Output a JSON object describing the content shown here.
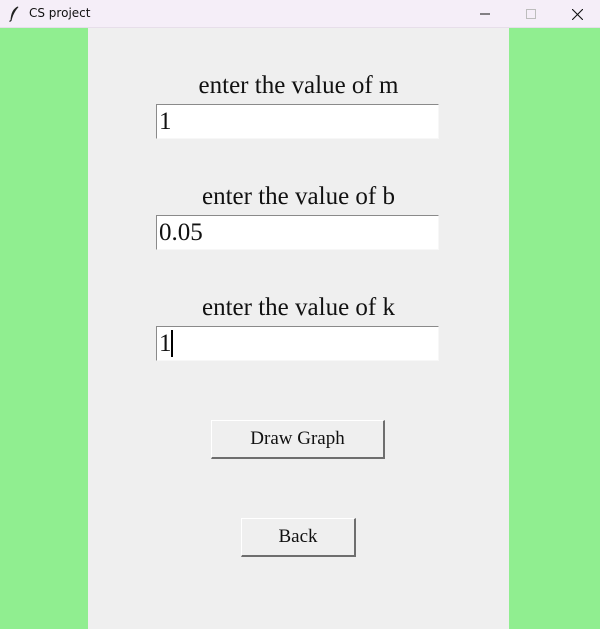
{
  "window": {
    "title": "CS project",
    "icon": "feather-icon",
    "controls": [
      "minimize-icon",
      "maximize-icon",
      "close-icon"
    ]
  },
  "colors": {
    "side_panels": "#90ee90",
    "background": "#efefef",
    "titlebar": "#f5eef8"
  },
  "form": {
    "m": {
      "label": "enter the value of m",
      "value": "1"
    },
    "b": {
      "label": "enter the value of b",
      "value": "0.05"
    },
    "k": {
      "label": "enter the value of k",
      "value": "1"
    }
  },
  "buttons": {
    "draw_graph": "Draw Graph",
    "back": "Back"
  }
}
